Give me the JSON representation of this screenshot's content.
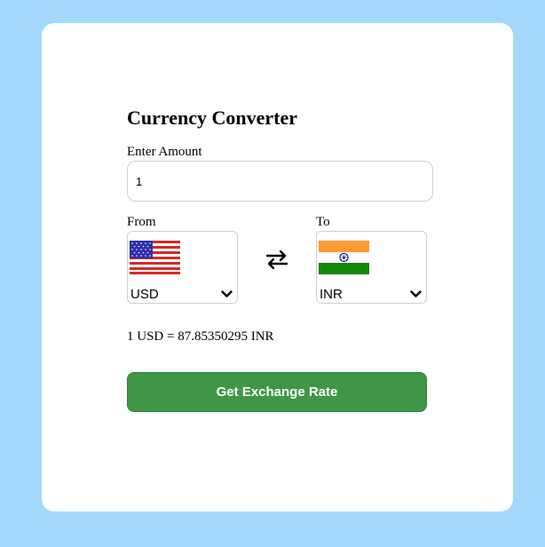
{
  "app": {
    "title": "Currency Converter",
    "amount_label": "Enter Amount",
    "amount_value": "1",
    "from_label": "From",
    "to_label": "To",
    "from_currency": {
      "code": "USD",
      "flag_icon": "us-flag-icon"
    },
    "to_currency": {
      "code": "INR",
      "flag_icon": "india-flag-icon"
    },
    "swap_icon": "swap-arrows-icon",
    "result_text": "1 USD = 87.85350295 INR",
    "button_label": "Get Exchange Rate"
  },
  "colors": {
    "background": "#a3d8fc",
    "card": "#ffffff",
    "button": "#3f9647",
    "button_text": "#ffffff"
  }
}
